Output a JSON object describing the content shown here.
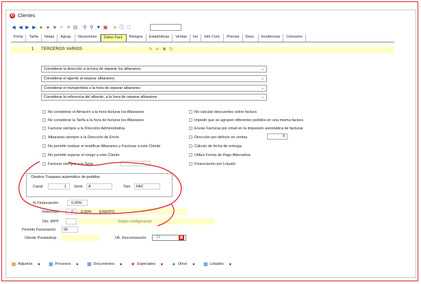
{
  "window": {
    "title": "Clientes",
    "logo_letter": "D"
  },
  "toolbar": {
    "icons": [
      "first-icon",
      "prev-icon",
      "next-icon",
      "last-icon",
      "add-icon",
      "delete-icon",
      "cancel-icon",
      "save-icon",
      "copy-icon",
      "print-icon",
      "search-icon",
      "info-icon",
      "filter-icon",
      "export-icon",
      "user-icon",
      "help-icon",
      "document-icon"
    ],
    "search_value": ""
  },
  "tabs": [
    "Ficha",
    "Tarifa",
    "Notas",
    "Agrup.",
    "Vacaciones",
    "Datos Fact.",
    "Riesgos",
    "Estadísticas",
    "Ventas",
    "Iso",
    "Info Com.",
    "Precios",
    "Desc.",
    "Incidencias",
    "Consumo"
  ],
  "active_tab": "Datos Fact.",
  "header": {
    "code": "1",
    "name": "TERCEROS VARIOS"
  },
  "dropdowns": [
    "Considerar la dirección a la hora de separar los albaranes.",
    "Considerar el agente al separar albaranes.",
    "Considerar el transportista a la hora de separar albaranes",
    "Considerar la referencia del albarán, a la hora de separar albaranes"
  ],
  "left_checks": [
    "No considerar el Almacén a la hora facturar los Albaranes",
    "No considerar la Tarifa a la hora de facturar los Albaranes",
    "Facturar siempre a la Dirección Administrativa",
    "Albaranes siempre a la Dirección de Envío",
    "No permitir realizar ni modificar Albaranes y Facturas a este Cliente",
    "No permitir superar el riesgo a este Cliente",
    "Facturar siempre a la Serie"
  ],
  "right_checks": [
    "No calcular descuentos sobre factura",
    "Impedir que se agrupen diferentes pedidos en una misma factura",
    "Enviar Facturas por email en la impresión automática de facturas",
    "Dirección por defecto en ventas",
    "Cálculo de fecha de entrega",
    "Utiliza Forma de Pago Alternativa",
    "Financiación por Líquido"
  ],
  "direccion_defecto_value": "0",
  "traspaso": {
    "legend": "Destino Traspaso automático de pedidos",
    "canal_label": "Canal",
    "canal_value": "1",
    "serie_label": "Serie",
    "serie_value": "A",
    "tipo_label": "Tipo",
    "tipo_value": "FAC"
  },
  "financiacion": {
    "label": "% Financiación",
    "value": "0,00%"
  },
  "retencion": {
    "label": "Retención",
    "code": "0",
    "pct": "0,00%",
    "desc": "EXENTO"
  },
  "dto_irpf": {
    "label": "Dto. IRPF",
    "desc": "Según configuración"
  },
  "periodo_facturacion": {
    "label": "Período Facturación",
    "value": "00"
  },
  "cliente_prestashop": {
    "label": "Cliente Prestashop",
    "value": ""
  },
  "ult_sincronizacion": {
    "label": "Últ. Sincronización",
    "value": "/ /"
  },
  "bottom_bar": [
    "Adjuntos",
    "Procesos",
    "Documentos",
    "Especiales",
    "Otros",
    "Listados"
  ],
  "colors": {
    "accent_red": "#d7202a",
    "highlight_yellow": "#ffffc8"
  }
}
